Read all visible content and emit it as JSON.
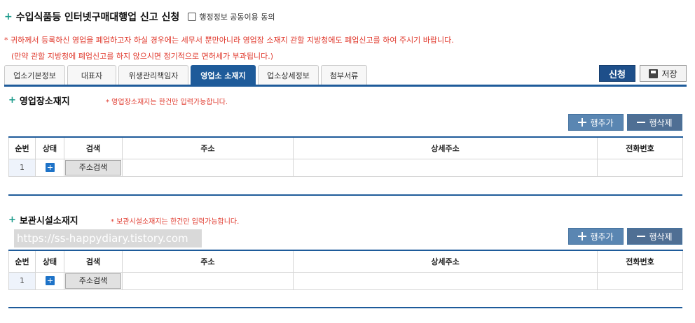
{
  "header": {
    "title": "수입식품등 인터넷구매대행업 신고 신청",
    "consent_label": "행정정보 공동이용 동의",
    "warning_line1": "* 귀하께서 등록하신 영업을 폐업하고자 하실 경우에는 세무서 뿐만아니라 영업장 소재지 관할 지방청에도 폐업신고를 하여 주시기 바랍니다.",
    "warning_line2": "(만약 관할 지방청에 폐업신고를 하지 않으시면 정기적으로 면허세가 부과됩니다.)"
  },
  "tabs": [
    {
      "label": "업소기본정보"
    },
    {
      "label": "대표자"
    },
    {
      "label": "위생관리책임자"
    },
    {
      "label": "영업소 소재지",
      "active": true
    },
    {
      "label": "업소상세정보"
    },
    {
      "label": "첨부서류"
    }
  ],
  "actions": {
    "apply_label": "신청",
    "save_label": "저장"
  },
  "section1": {
    "title": "영업장소재지",
    "note": "* 영업장소재지는 한건만 입력가능합니다.",
    "add_label": "행추가",
    "delete_label": "행삭제",
    "columns": [
      "순번",
      "상태",
      "검색",
      "주소",
      "상세주소",
      "전화번호"
    ],
    "rows": [
      {
        "no": "1",
        "search_label": "주소검색",
        "address": "",
        "detail": "",
        "phone": ""
      }
    ]
  },
  "section2": {
    "title": "보관시설소재지",
    "note": "* 보관시설소재지는 한건만 입력가능합니다.",
    "add_label": "행추가",
    "delete_label": "행삭제",
    "columns": [
      "순번",
      "상태",
      "검색",
      "주소",
      "상세주소",
      "전화번호"
    ],
    "rows": [
      {
        "no": "1",
        "search_label": "주소검색",
        "address": "",
        "detail": "",
        "phone": ""
      }
    ]
  },
  "watermark": "https://ss-happydiary.tistory.com",
  "colors": {
    "accent": "#1e5b9a",
    "warning": "#e03a2e",
    "plus": "#1a9a8a"
  }
}
